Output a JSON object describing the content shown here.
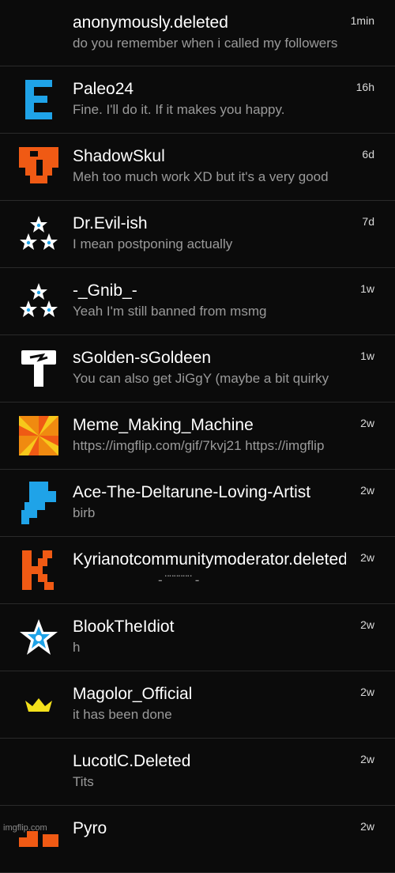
{
  "conversations": [
    {
      "name": "anonymously.deleted",
      "message": "do you remember when i called my followers",
      "time": "1min",
      "avatar": "none"
    },
    {
      "name": "Paleo24",
      "message": "Fine. I'll do it. If it makes you happy.",
      "time": "16h",
      "avatar": "letter-e-icon"
    },
    {
      "name": "ShadowSkul",
      "message": "Meh too much work XD but it's a very good",
      "time": "6d",
      "avatar": "orange-pixel-skull-icon"
    },
    {
      "name": "Dr.Evil-ish",
      "message": "I mean postponing actually",
      "time": "7d",
      "avatar": "three-stars-icon"
    },
    {
      "name": "-_Gnib_-",
      "message": "Yeah I'm still banned from msmg",
      "time": "1w",
      "avatar": "three-stars-icon"
    },
    {
      "name": "sGolden-sGoldeen",
      "message": "You can also get JiGgY (maybe a bit quirky",
      "time": "1w",
      "avatar": "hammer-icon"
    },
    {
      "name": "Meme_Making_Machine",
      "message": "https://imgflip.com/gif/7kvj21 https://imgflip",
      "time": "2w",
      "avatar": "pinwheel-icon"
    },
    {
      "name": "Ace-The-Deltarune-Loving-Artist",
      "message": "birb",
      "time": "2w",
      "avatar": "blue-pixel-bird-icon"
    },
    {
      "name": "Kyrianotcommunitymoderator.deleted",
      "message": "- ̈ ̈  ̈ ̈  ̈ ̈ -",
      "time": "2w",
      "avatar": "letter-k-icon"
    },
    {
      "name": "BlookTheIdiot",
      "message": "h",
      "time": "2w",
      "avatar": "star-icon"
    },
    {
      "name": "Magolor_Official",
      "message": "it has been done",
      "time": "2w",
      "avatar": "crown-icon"
    },
    {
      "name": "LucotlC.Deleted",
      "message": "Tits",
      "time": "2w",
      "avatar": "none"
    },
    {
      "name": "Pyro",
      "message": "",
      "time": "2w",
      "avatar": "orange-pixel-icon"
    }
  ],
  "watermark": "imgflip.com",
  "colors": {
    "background": "#0b0b0b",
    "name": "#ffffff",
    "message": "#9a9a9a",
    "accent_blue": "#1fa3e8",
    "accent_orange": "#f05a14"
  }
}
